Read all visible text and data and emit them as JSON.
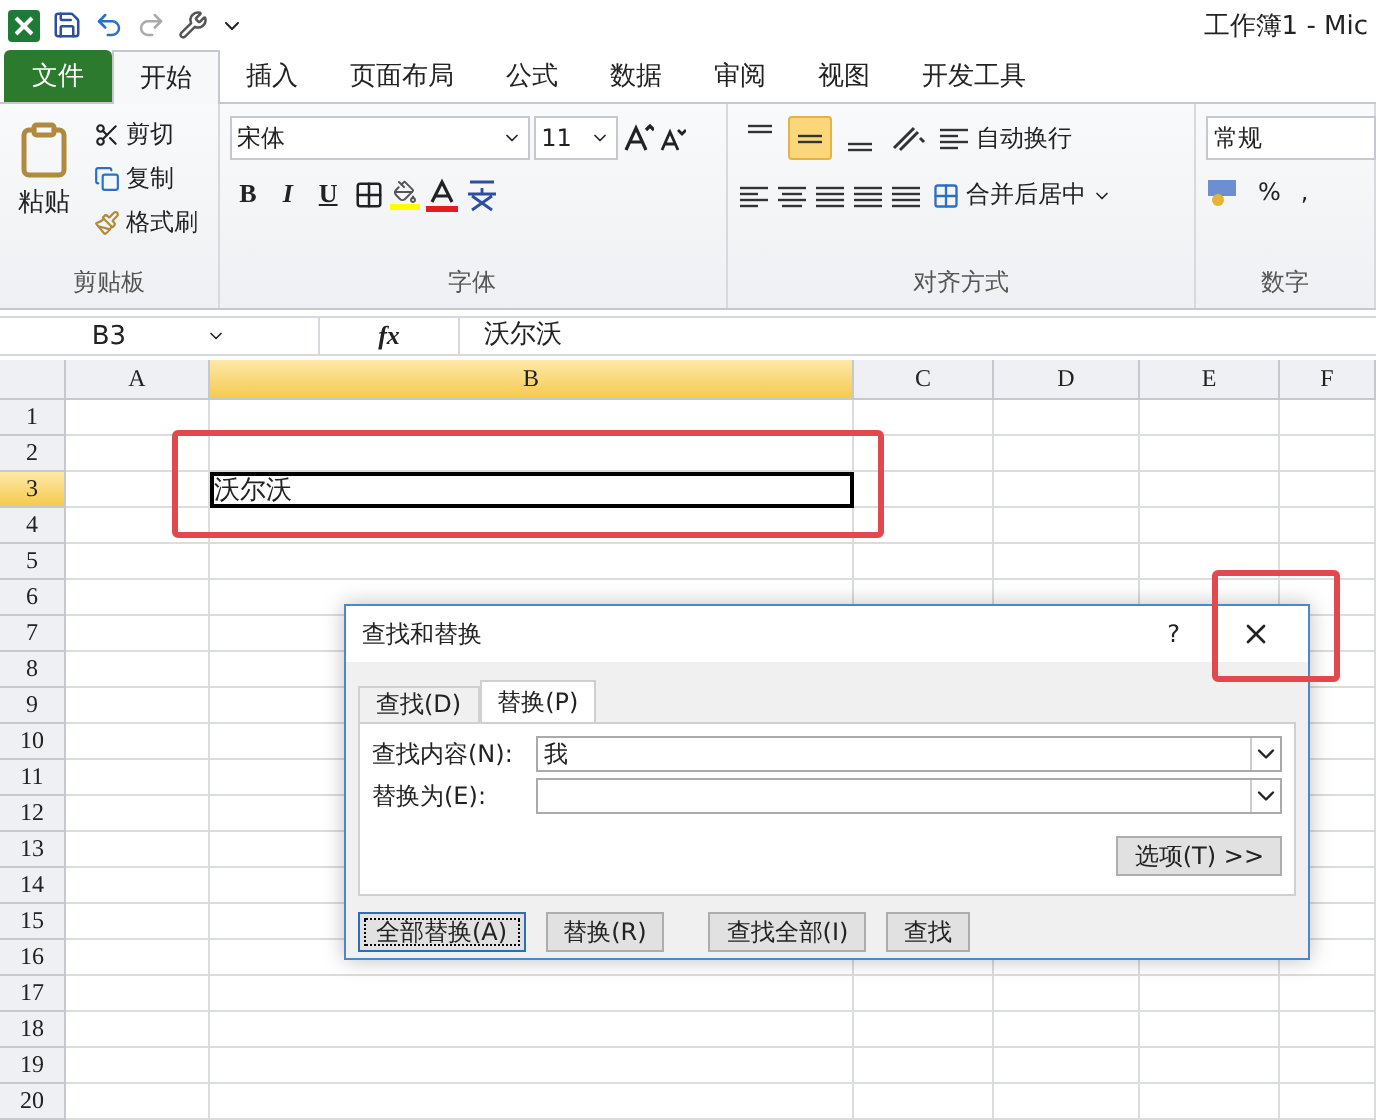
{
  "window": {
    "title": "工作簿1 - Mic"
  },
  "tabs": [
    {
      "label": "文件",
      "kind": "file",
      "selected": false
    },
    {
      "label": "开始",
      "kind": "tab",
      "selected": true
    },
    {
      "label": "插入",
      "kind": "tab",
      "selected": false
    },
    {
      "label": "页面布局",
      "kind": "tab",
      "selected": false
    },
    {
      "label": "公式",
      "kind": "tab",
      "selected": false
    },
    {
      "label": "数据",
      "kind": "tab",
      "selected": false
    },
    {
      "label": "审阅",
      "kind": "tab",
      "selected": false
    },
    {
      "label": "视图",
      "kind": "tab",
      "selected": false
    },
    {
      "label": "开发工具",
      "kind": "tab",
      "selected": false
    }
  ],
  "ribbon": {
    "clipboard": {
      "paste": "粘贴",
      "cut": "剪切",
      "copy": "复制",
      "format_painter": "格式刷",
      "label": "剪贴板"
    },
    "font": {
      "font_name": "宋体",
      "font_size": "11",
      "styles": [
        "B",
        "I",
        "U"
      ],
      "label": "字体"
    },
    "alignment": {
      "vertical": [
        {
          "selected": false
        },
        {
          "selected": true
        },
        {
          "selected": false
        }
      ],
      "wrap": "自动换行",
      "merge": "合并后居中",
      "label": "对齐方式"
    },
    "number": {
      "format": "常规",
      "percent": "%",
      "comma": ",",
      "label": "数字"
    }
  },
  "formula_bar": {
    "name_box": "B3",
    "fx": "fx",
    "value": "沃尔沃"
  },
  "sheet": {
    "columns": [
      {
        "label": "A",
        "selected": false
      },
      {
        "label": "B",
        "selected": true
      },
      {
        "label": "C",
        "selected": false
      },
      {
        "label": "D",
        "selected": false
      },
      {
        "label": "E",
        "selected": false
      },
      {
        "label": "F",
        "selected": false
      }
    ],
    "rows": [
      {
        "label": "1",
        "selected": false
      },
      {
        "label": "2",
        "selected": false
      },
      {
        "label": "3",
        "selected": true,
        "cells": {
          "B": "沃尔沃"
        }
      },
      {
        "label": "4",
        "selected": false
      },
      {
        "label": "5",
        "selected": false
      },
      {
        "label": "6",
        "selected": false
      },
      {
        "label": "7",
        "selected": false
      },
      {
        "label": "8",
        "selected": false
      },
      {
        "label": "9",
        "selected": false
      },
      {
        "label": "10",
        "selected": false
      },
      {
        "label": "11",
        "selected": false
      },
      {
        "label": "12",
        "selected": false
      },
      {
        "label": "13",
        "selected": false
      },
      {
        "label": "14",
        "selected": false
      },
      {
        "label": "15",
        "selected": false
      },
      {
        "label": "16",
        "selected": false
      },
      {
        "label": "17",
        "selected": false
      },
      {
        "label": "18",
        "selected": false
      },
      {
        "label": "19",
        "selected": false
      },
      {
        "label": "20",
        "selected": false
      }
    ]
  },
  "dialog": {
    "title": "查找和替换",
    "help": "?",
    "tabs": [
      {
        "label": "查找(D)",
        "selected": false
      },
      {
        "label": "替换(P)",
        "selected": true
      }
    ],
    "fields": [
      {
        "label": "查找内容(N):",
        "value": "我"
      },
      {
        "label": "替换为(E):"
      }
    ],
    "options": "选项(T) >>",
    "buttons": [
      {
        "label": "全部替换(A)",
        "default": true
      },
      {
        "label": "替换(R)",
        "default": false
      },
      {
        "label": "查找全部(I)",
        "default": false
      },
      {
        "label": "查找",
        "default": false
      }
    ]
  }
}
